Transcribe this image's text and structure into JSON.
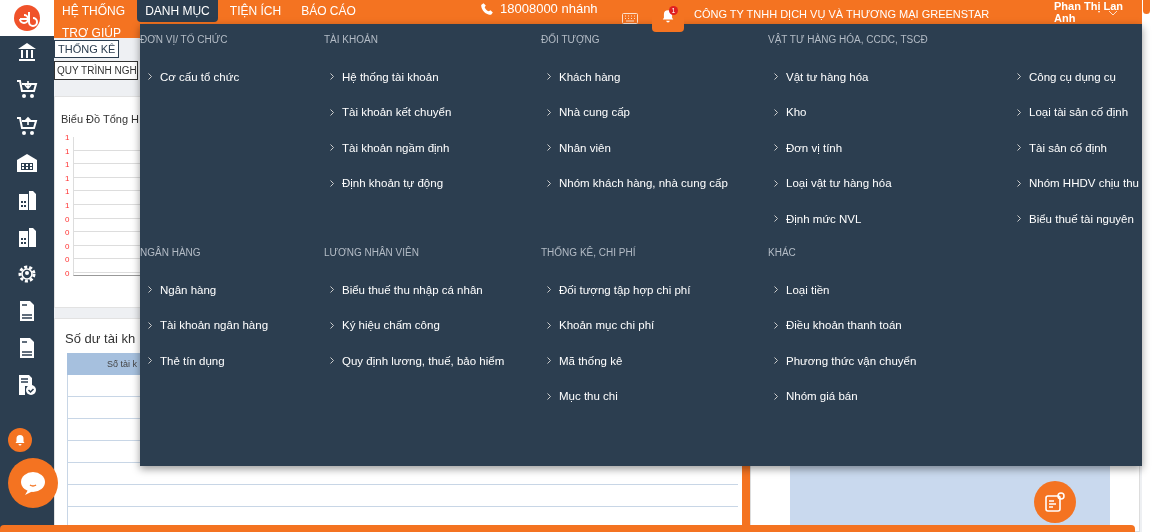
{
  "header": {
    "nav": [
      {
        "label": "HỆ THỐNG",
        "selected": false
      },
      {
        "label": "DANH MỤC",
        "selected": true
      },
      {
        "label": "TIỆN ÍCH",
        "selected": false
      },
      {
        "label": "BÁO CÁO",
        "selected": false
      },
      {
        "label": "TRỢ GIÚP",
        "selected": false
      }
    ],
    "hotline": "18008000 nhánh",
    "notification_count": "1",
    "company": "CÔNG TY TNHH DỊCH VỤ VÀ THƯƠNG MẠI GREENSTAR",
    "user": "Phan Thị Lan Anh"
  },
  "content": {
    "tab": "THỐNG KÊ",
    "process_field": "QUY TRÌNH NGH",
    "chart_card": {
      "title": "Biểu Đồ Tổng H",
      "y_labels": [
        "1",
        "1",
        "1",
        "1",
        "1",
        "1",
        "0",
        "0",
        "0",
        "0",
        "0"
      ]
    },
    "balance_card": {
      "title": "Số dư tài kh",
      "column_1": "Số tài k"
    }
  },
  "menu": {
    "rows": [
      [
        {
          "heading": "ĐƠN VỊ/ TỔ CHỨC",
          "items": [
            "Cơ cấu tổ chức"
          ]
        },
        {
          "heading": "TÀI KHOẢN",
          "items": [
            "Hệ thống tài khoản",
            "Tài khoản kết chuyển",
            "Tài khoản ngầm định",
            "Định khoản tự động"
          ]
        },
        {
          "heading": "ĐỐI TƯỢNG",
          "items": [
            "Khách hàng",
            "Nhà cung cấp",
            "Nhân viên",
            "Nhóm khách hàng, nhà cung cấp"
          ]
        },
        {
          "heading": "VẬT TƯ HÀNG HÓA, CCDC, TSCĐ",
          "items": [
            "Vật tư hàng hóa",
            "Kho",
            "Đơn vị tính",
            "Loại vật tư hàng hóa",
            "Định mức NVL"
          ]
        },
        {
          "items": [
            "Công cụ dụng cụ",
            "Loại tài sản cố định",
            "Tài sản cố định",
            "Nhóm HHDV chịu thu",
            "Biểu thuế tài nguyên"
          ]
        }
      ],
      [
        {
          "heading": "NGÂN HÀNG",
          "items": [
            "Ngân hàng",
            "Tài khoản ngân hàng",
            "Thẻ tín dụng"
          ]
        },
        {
          "heading": "LƯƠNG NHÂN VIÊN",
          "items": [
            "Biểu thuế thu nhập cá nhân",
            "Ký hiệu chấm công",
            "Quy định lương, thuế, bảo hiểm"
          ]
        },
        {
          "heading": "THỐNG KÊ, CHI PHÍ",
          "items": [
            "Đối tượng tập hợp chi phí",
            "Khoản mục chi phí",
            "Mã thống kê",
            "Mục thu chi"
          ]
        },
        {
          "heading": "KHÁC",
          "items": [
            "Loại tiền",
            "Điều khoản thanh toán",
            "Phương thức vận chuyển",
            "Nhóm giá bán"
          ]
        }
      ]
    ]
  }
}
